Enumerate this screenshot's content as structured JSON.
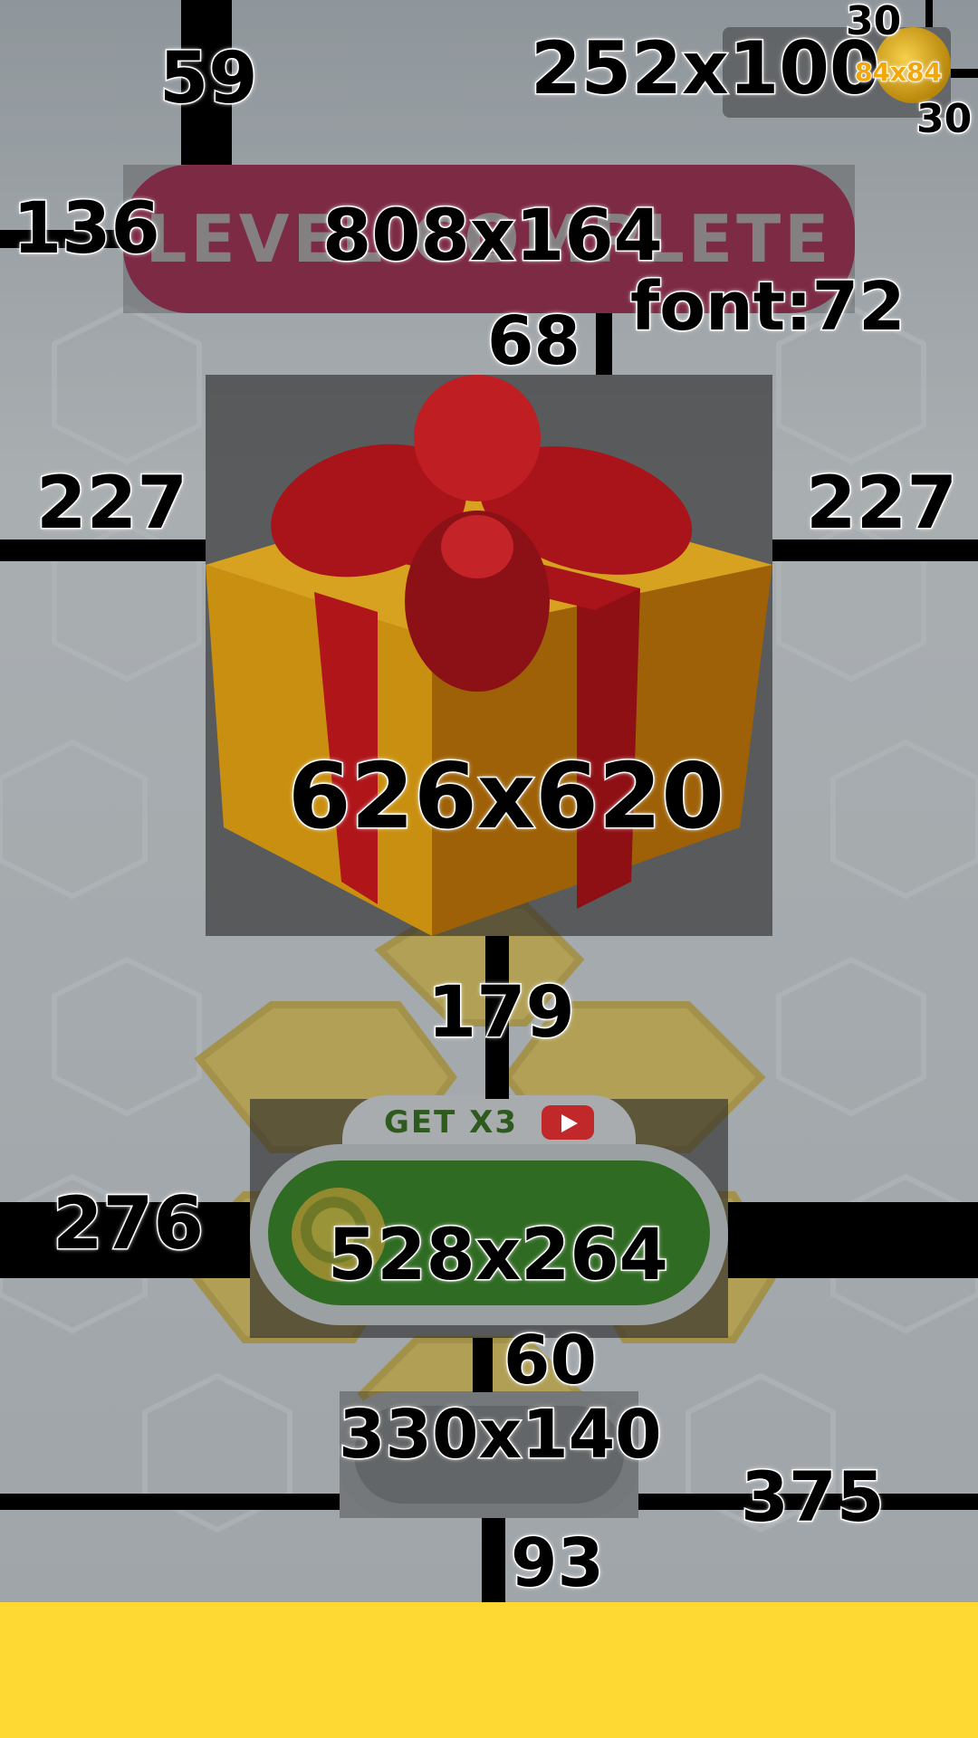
{
  "banner": {
    "text": "LEVEL COMPLETE"
  },
  "reward_button": {
    "label": "GET X3"
  },
  "annotations": {
    "coin_counter_size": "252x100",
    "coin_icon_size": "84x84",
    "coin_top_margin": "30",
    "coin_right_margin": "30",
    "counter_top_margin": "59",
    "banner_size": "808x164",
    "banner_side_margin": "136",
    "banner_font": "font:72",
    "banner_gift_gap": "68",
    "gift_size": "626x620",
    "gift_left_margin": "227",
    "gift_right_margin": "227",
    "gift_button_gap": "179",
    "button_size": "528x264",
    "button_side_margin": "276",
    "button_gap": "60",
    "small_button_size": "330x140",
    "small_button_margin": "375",
    "bottom_gap": "93"
  },
  "colors": {
    "banner": "#9c1e46",
    "button_green": "#2f6b22",
    "bottom_bar": "#ffd933",
    "youtube_red": "#c0282a"
  }
}
